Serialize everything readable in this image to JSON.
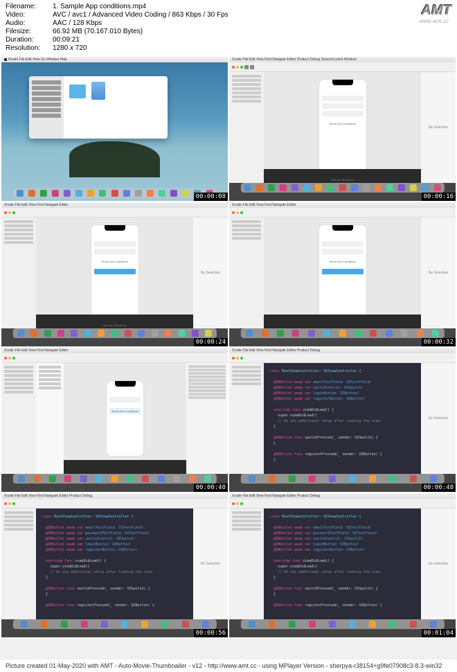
{
  "header": {
    "filename_label": "Filename:",
    "filename_value": "1. Sample App conditions.mp4",
    "video_label": "Video:",
    "video_value": "AVC / avc1 / Advanced Video Coding / 863 Kbps / 30 Fps",
    "audio_label": "Audio:",
    "audio_value": "AAC / 128 Kbps",
    "filesize_label": "Filesize:",
    "filesize_value": "66.92 MB (70.167.010 Bytes)",
    "duration_label": "Duration:",
    "duration_value": "00:09:21",
    "resolution_label": "Resolution:",
    "resolution_value": "1280 x 720"
  },
  "logo_text": "AMT",
  "logo_url": "www.amt.cc",
  "thumbnails": [
    {
      "timestamp": "00:00:08"
    },
    {
      "timestamp": "00:00:16"
    },
    {
      "timestamp": "00:00:24"
    },
    {
      "timestamp": "00:00:32"
    },
    {
      "timestamp": "00:00:40"
    },
    {
      "timestamp": "00:00:48"
    },
    {
      "timestamp": "00:00:56"
    },
    {
      "timestamp": "00:01:04"
    }
  ],
  "phone_content": {
    "terms_text": "Terms and Conditions",
    "device_label": "View as: iPhone 11"
  },
  "xcode": {
    "no_selection": "No Selection"
  },
  "code": {
    "class_decl": "class",
    "class_name": "RootViewController: UIViewController {",
    "outlet": "@IBOutlet weak var",
    "outlets": [
      "emailTextField: UITextField!",
      "passwordTextField: UITextField!",
      "switchControl: UISwitch!",
      "loginButton: UIButton!",
      "registerButton: UIButton!"
    ],
    "override": "override func",
    "viewdidload": "viewDidLoad() {",
    "super_call": "super.viewDidLoad()",
    "comment": "// Do any additional setup after loading the view.",
    "action": "@IBAction func",
    "switch_pressed": "switchPressed(_ sender: UISwitch) {",
    "register_pressed": "registerPressed(_ sender: UIButton) {"
  },
  "footer_text": "Picture created 01-May-2020 with AMT - Auto-Movie-Thumbnailer - v12 - http://www.amt.cc - using MPlayer Version - sherpya-r38154+g9fe07908c3-8.3-win32"
}
